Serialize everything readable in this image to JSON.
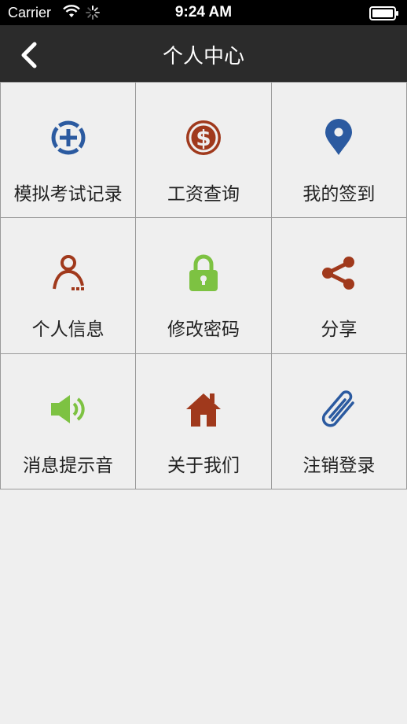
{
  "status_bar": {
    "carrier": "Carrier",
    "time": "9:24 AM",
    "icons": [
      "wifi-icon",
      "activity-spinner-icon",
      "battery-icon"
    ]
  },
  "nav": {
    "title": "个人中心",
    "back_icon": "chevron-left-icon"
  },
  "colors": {
    "nav_background": "#2b2b2b",
    "page_background": "#efefef",
    "blue_icon": "#2b5aa0",
    "red_icon": "#a0391c",
    "green_icon": "#7dc242"
  },
  "menu": {
    "items": [
      {
        "label": "模拟考试记录",
        "icon": "target-plus-icon",
        "color": "#2b5aa0"
      },
      {
        "label": "工资查询",
        "icon": "dollar-circle-icon",
        "color": "#a0391c"
      },
      {
        "label": "我的签到",
        "icon": "map-pin-icon",
        "color": "#2b5aa0"
      },
      {
        "label": "个人信息",
        "icon": "person-icon",
        "color": "#a0391c"
      },
      {
        "label": "修改密码",
        "icon": "lock-icon",
        "color": "#7dc242"
      },
      {
        "label": "分享",
        "icon": "share-icon",
        "color": "#a0391c"
      },
      {
        "label": "消息提示音",
        "icon": "speaker-icon",
        "color": "#7dc242"
      },
      {
        "label": "关于我们",
        "icon": "home-icon",
        "color": "#a0391c"
      },
      {
        "label": "注销登录",
        "icon": "paperclip-icon",
        "color": "#2b5aa0"
      }
    ]
  }
}
